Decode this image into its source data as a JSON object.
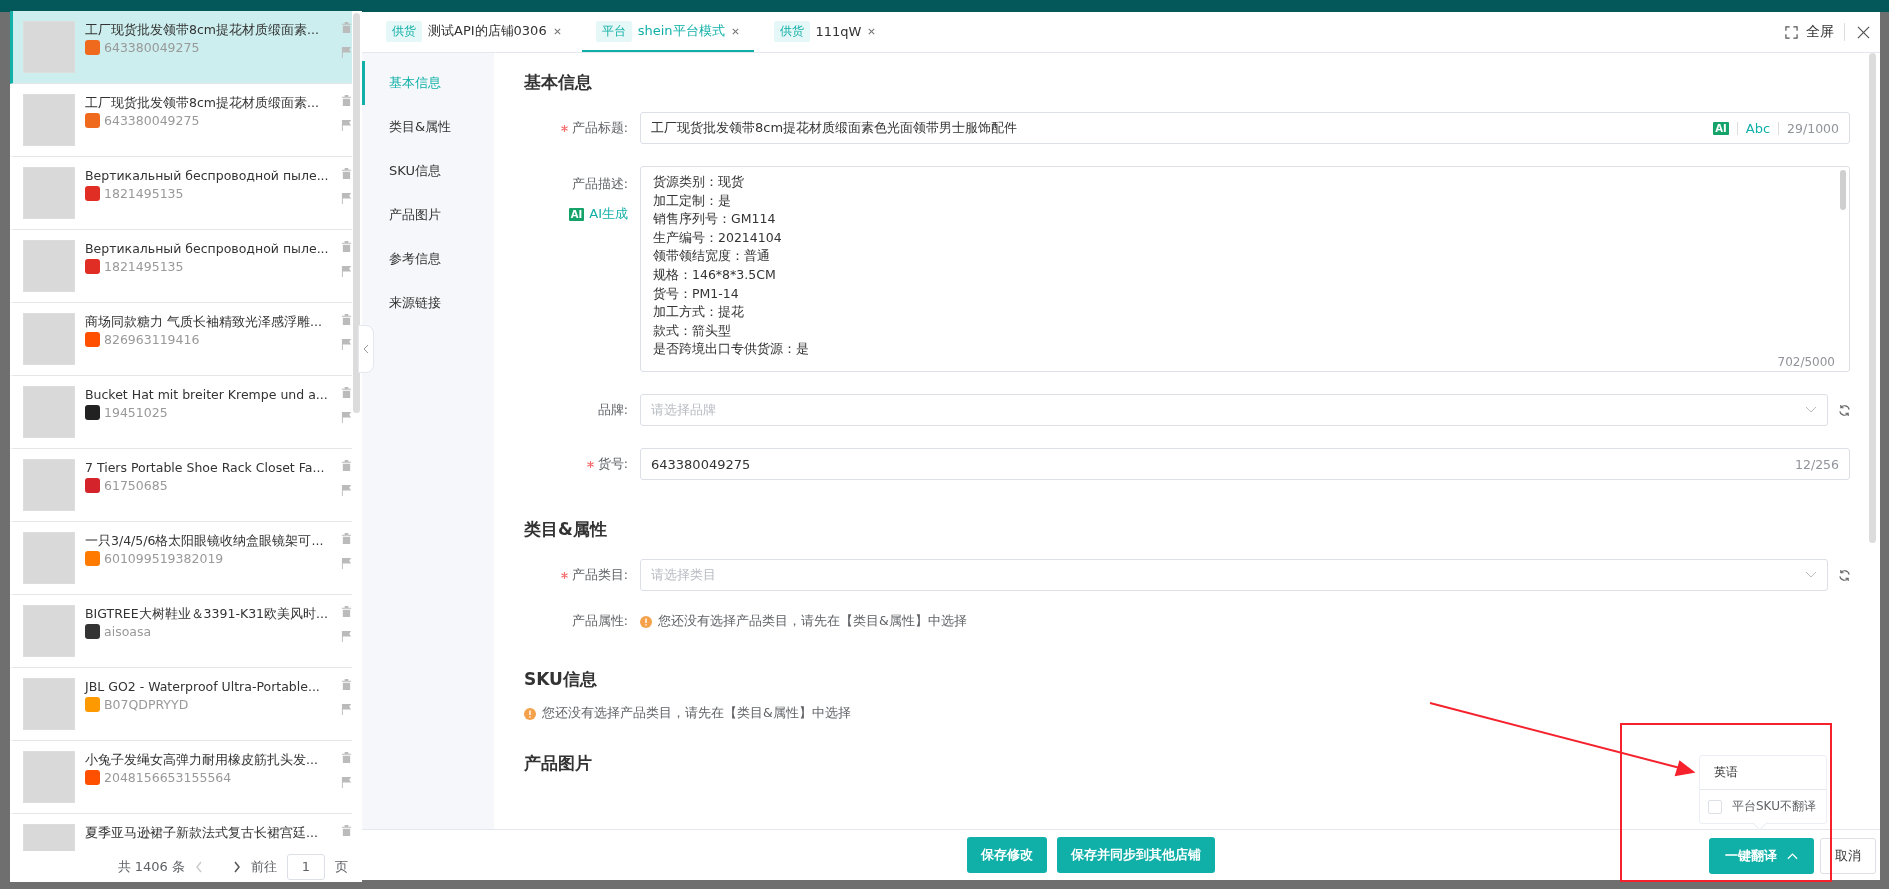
{
  "list": {
    "items": [
      {
        "title": "工厂现货批发领带8cm提花材质缎面素...",
        "id": "643380049275",
        "color": "#f06a1e",
        "selected": true
      },
      {
        "title": "工厂现货批发领带8cm提花材质缎面素...",
        "id": "643380049275",
        "color": "#f06a1e",
        "selected": false
      },
      {
        "title": "Вертикальный беспроводной пыле...",
        "id": "1821495135",
        "color": "#e02e24",
        "selected": false
      },
      {
        "title": "Вертикальный беспроводной пыле...",
        "id": "1821495135",
        "color": "#e02e24",
        "selected": false
      },
      {
        "title": "商场同款糖力 气质长袖精致光泽感浮雕...",
        "id": "826963119416",
        "color": "#ff5000",
        "selected": false
      },
      {
        "title": "Bucket Hat mit breiter Krempe und a...",
        "id": "19451025",
        "color": "#222222",
        "selected": false
      },
      {
        "title": "7 Tiers Portable Shoe Rack Closet Fa...",
        "id": "61750685",
        "color": "#d4232a",
        "selected": false
      },
      {
        "title": "一只3/4/5/6格太阳眼镜收纳盒眼镜架可...",
        "id": "601099519382019",
        "color": "#ff7a00",
        "selected": false
      },
      {
        "title": "BIGTREE大树鞋业＆3391-K31欧美风时...",
        "id": "aisoasa",
        "color": "#333333",
        "selected": false
      },
      {
        "title": "JBL GO2 - Waterproof Ultra-Portable...",
        "id": "B07QDPRYYD",
        "color": "#ff9900",
        "selected": false
      },
      {
        "title": "小兔子发绳女高弹力耐用橡皮筋扎头发...",
        "id": "2048156653155564",
        "color": "#ff5000",
        "selected": false
      },
      {
        "title": "夏季亚马逊裙子新款法式复古长裙宫廷...",
        "selected": false
      }
    ],
    "pager": {
      "total": "共 1406 条",
      "goto": "前往",
      "page": "1",
      "unit": "页"
    }
  },
  "tabs": [
    {
      "tag": "供货",
      "label": "测试API的店铺0306",
      "selected": false
    },
    {
      "tag": "平台",
      "label": "shein平台模式",
      "selected": true
    },
    {
      "tag": "供货",
      "label": "111qW",
      "selected": false
    }
  ],
  "fullscreen": "全屏",
  "nav": [
    {
      "label": "基本信息",
      "selected": true
    },
    {
      "label": "类目&属性",
      "selected": false
    },
    {
      "label": "SKU信息",
      "selected": false
    },
    {
      "label": "产品图片",
      "selected": false
    },
    {
      "label": "参考信息",
      "selected": false
    },
    {
      "label": "来源链接",
      "selected": false
    }
  ],
  "basic": {
    "title": "基本信息",
    "product_title": {
      "label": "产品标题:",
      "required": true,
      "value": "工厂现货批发领带8cm提花材质缎面素色光面领带男士服饰配件",
      "ai": "AI",
      "abc": "Abc",
      "counter": "29/1000"
    },
    "description": {
      "label": "产品描述:",
      "ai_badge": "AI",
      "ai_button": "AI生成",
      "counter": "702/5000",
      "lines": [
        "货源类别：现货",
        "加工定制：是",
        "销售序列号：GM114",
        "生产编号：20214104",
        "领带领结宽度：普通",
        "规格：146*8*3.5CM",
        "货号：PM1-14",
        "加工方式：提花",
        "款式：箭头型",
        "是否跨境出口专供货源：是"
      ]
    },
    "brand": {
      "label": "品牌:",
      "required": false,
      "placeholder": "请选择品牌"
    },
    "sku_code": {
      "label": "货号:",
      "required": true,
      "value": "643380049275",
      "counter": "12/256"
    }
  },
  "category": {
    "title": "类目&属性",
    "category": {
      "label": "产品类目:",
      "required": true,
      "placeholder": "请选择类目"
    },
    "attributes": {
      "label": "产品属性:",
      "notice": "您还没有选择产品类目，请先在【类目&属性】中选择"
    }
  },
  "sku": {
    "title": "SKU信息",
    "notice": "您还没有选择产品类目，请先在【类目&属性】中选择"
  },
  "images": {
    "title": "产品图片"
  },
  "footer": {
    "buttons": [
      "保存修改",
      "保存并同步到其他店铺"
    ],
    "translate": "一键翻译",
    "cancel": "取消"
  },
  "translate_popover": {
    "language": "英语",
    "option": {
      "label": "平台SKU不翻译",
      "checked": false
    }
  }
}
